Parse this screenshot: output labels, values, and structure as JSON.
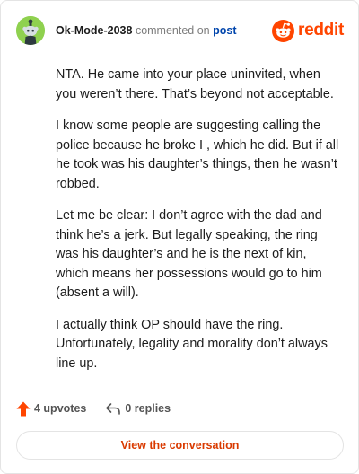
{
  "header": {
    "author": "Ok-Mode-2038",
    "commented_on": "commented on",
    "post_link": "post",
    "brand": "reddit"
  },
  "comment": {
    "paragraphs": [
      "NTA. He came into your place uninvited, when you weren’t there. That’s beyond not acceptable.",
      "I know some people are suggesting calling the police because he broke I , which he did. But if all he took was his daughter’s things, then he wasn’t robbed.",
      "Let me be clear: I don’t agree with the dad and think he’s a jerk. But legally speaking, the ring was his daughter’s and he is the next of kin, which means her possessions would go to him (absent a will).",
      "I actually think OP should have the ring. Unfortunately, legality and morality don’t always line up."
    ]
  },
  "actions": {
    "upvotes": "4 upvotes",
    "replies": "0 replies"
  },
  "cta": {
    "label": "View the conversation"
  },
  "icons": {
    "avatar": "snoo-avatar-icon",
    "brand": "reddit-logo-icon",
    "upvote": "upvote-arrow-icon",
    "reply": "reply-arrow-icon"
  },
  "colors": {
    "brand": "#ff4500",
    "avatar_background": "#8fd14f",
    "link": "#0045ac",
    "cta_text": "#d93a00"
  }
}
